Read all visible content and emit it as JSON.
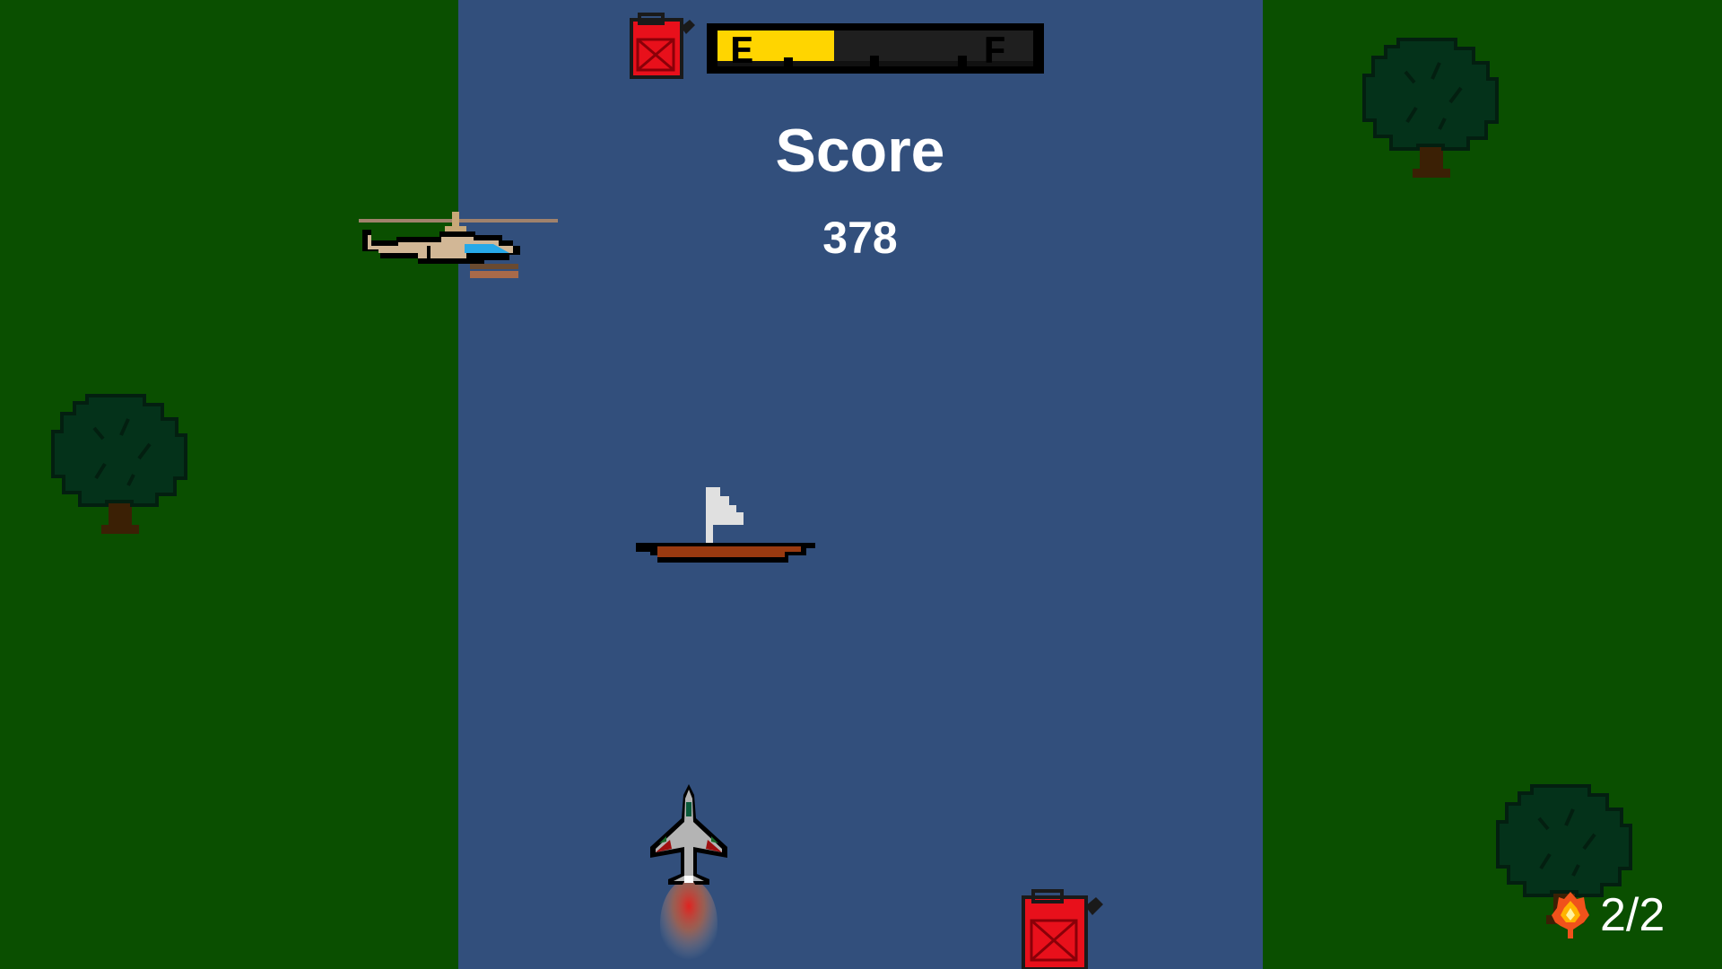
{
  "hud": {
    "fuel": {
      "icon": "fuel-can-icon",
      "empty_label": "E",
      "full_label": "F",
      "level": 0.37,
      "fill_color": "#ffd500"
    },
    "score": {
      "label": "Score",
      "value": "378"
    },
    "lives": {
      "icon": "fire-icon",
      "text": "2/2"
    }
  },
  "scene": {
    "river_color": "#324f7c",
    "bank_color": "#0a4f00",
    "sprites": [
      "helicopter",
      "sailboat",
      "fighter-jet",
      "fuel-can",
      "tree",
      "tree",
      "tree"
    ]
  }
}
